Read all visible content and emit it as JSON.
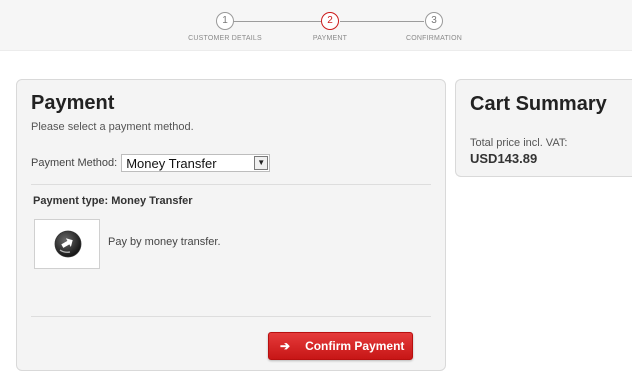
{
  "stepper": {
    "steps": [
      {
        "number": "1",
        "label": "CUSTOMER DETAILS"
      },
      {
        "number": "2",
        "label": "PAYMENT"
      },
      {
        "number": "3",
        "label": "CONFIRMATION"
      }
    ],
    "active_step": "2",
    "accent_color": "#cc1b1b"
  },
  "payment": {
    "title": "Payment",
    "subtitle": "Please select a payment method.",
    "method_label": "Payment Method:",
    "method_selected": "Money Transfer",
    "payment_type": "Payment type: Money Transfer",
    "method_description": "Pay by money transfer.",
    "confirm_label": "Confirm Payment",
    "confirm_color": "#d92424"
  },
  "cart": {
    "title": "Cart Summary",
    "total_label": "Total price incl. VAT:",
    "total_value": "USD143.89"
  },
  "icons": {
    "logo": "money-transfer-icon",
    "arrow": "arrow-right-icon",
    "dropdown": "chevron-down-icon"
  }
}
